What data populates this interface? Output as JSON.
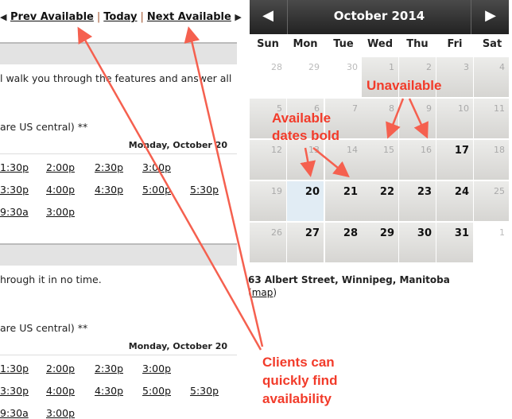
{
  "nav": {
    "prev_label": "Prev Available",
    "today_label": "Today",
    "next_label": "Next Available"
  },
  "sections": [
    {
      "description": "l walk you through the features and answer all",
      "timezone_note": " are US central) **",
      "date_header": "Monday, October 20",
      "time_rows": [
        [
          "1:30p",
          "2:00p",
          "2:30p",
          "3:00p"
        ],
        [
          "3:30p",
          "4:00p",
          "4:30p",
          "5:00p",
          "5:30p"
        ],
        [
          "9:30a",
          "3:00p"
        ]
      ]
    },
    {
      "description": "hrough it in no time.",
      "timezone_note": " are US central) **",
      "date_header": "Monday, October 20",
      "time_rows": [
        [
          "1:30p",
          "2:00p",
          "2:30p",
          "3:00p"
        ],
        [
          "3:30p",
          "4:00p",
          "4:30p",
          "5:00p",
          "5:30p"
        ],
        [
          "9:30a",
          "3:00p"
        ]
      ]
    }
  ],
  "calendar": {
    "title": "October 2014",
    "prev_icon": "triangle-left",
    "next_icon": "triangle-right",
    "weekdays": [
      "Sun",
      "Mon",
      "Tue",
      "Wed",
      "Thu",
      "Fri",
      "Sat"
    ],
    "weeks": [
      [
        {
          "d": "28",
          "s": "other"
        },
        {
          "d": "29",
          "s": "other"
        },
        {
          "d": "30",
          "s": "other"
        },
        {
          "d": "1",
          "s": "unavail"
        },
        {
          "d": "2",
          "s": "unavail"
        },
        {
          "d": "3",
          "s": "unavail"
        },
        {
          "d": "4",
          "s": "unavail"
        }
      ],
      [
        {
          "d": "5",
          "s": "unavail"
        },
        {
          "d": "6",
          "s": "unavail"
        },
        {
          "d": "7",
          "s": "unavail"
        },
        {
          "d": "8",
          "s": "unavail"
        },
        {
          "d": "9",
          "s": "unavail"
        },
        {
          "d": "10",
          "s": "unavail"
        },
        {
          "d": "11",
          "s": "unavail"
        }
      ],
      [
        {
          "d": "12",
          "s": "unavail"
        },
        {
          "d": "13",
          "s": "unavail"
        },
        {
          "d": "14",
          "s": "unavail"
        },
        {
          "d": "15",
          "s": "unavail"
        },
        {
          "d": "16",
          "s": "unavail"
        },
        {
          "d": "17",
          "s": "avail"
        },
        {
          "d": "18",
          "s": "unavail"
        }
      ],
      [
        {
          "d": "19",
          "s": "unavail"
        },
        {
          "d": "20",
          "s": "avail sel"
        },
        {
          "d": "21",
          "s": "avail"
        },
        {
          "d": "22",
          "s": "avail"
        },
        {
          "d": "23",
          "s": "avail"
        },
        {
          "d": "24",
          "s": "avail"
        },
        {
          "d": "25",
          "s": "unavail"
        }
      ],
      [
        {
          "d": "26",
          "s": "unavail"
        },
        {
          "d": "27",
          "s": "avail"
        },
        {
          "d": "28",
          "s": "avail"
        },
        {
          "d": "29",
          "s": "avail"
        },
        {
          "d": "30",
          "s": "avail"
        },
        {
          "d": "31",
          "s": "avail"
        },
        {
          "d": "1",
          "s": "other"
        }
      ]
    ]
  },
  "location": {
    "address": "63 Albert Street, Winnipeg, Manitoba",
    "map_label": "map",
    "open_paren": "(",
    "close_paren": ")"
  },
  "annotations": {
    "unavailable": "Unavailable",
    "available_1": "Available",
    "available_2": "dates bold",
    "clients_1": "Clients can",
    "clients_2": "quickly find",
    "clients_3": "availability",
    "color": "#f23b2a"
  }
}
